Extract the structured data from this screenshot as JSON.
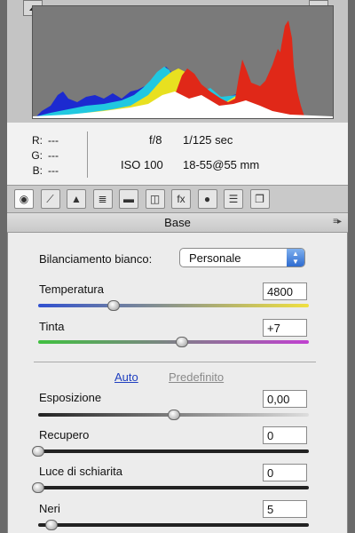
{
  "histogram": {
    "clip_left_icon": "triangle-up-icon",
    "clip_right_icon": "triangle-up-icon"
  },
  "readout": {
    "r_label": "R:",
    "r_value": "---",
    "g_label": "G:",
    "g_value": "---",
    "b_label": "B:",
    "b_value": "---",
    "aperture": "f/8",
    "shutter": "1/125 sec",
    "iso": "ISO 100",
    "lens": "18-55@55 mm"
  },
  "tabs": [
    {
      "icon": "aperture-icon",
      "glyph": "◉",
      "active": true
    },
    {
      "icon": "tone-curve-icon",
      "glyph": "⟋",
      "active": false
    },
    {
      "icon": "detail-icon",
      "glyph": "▲",
      "active": false
    },
    {
      "icon": "hsl-icon",
      "glyph": "≣",
      "active": false
    },
    {
      "icon": "split-toning-icon",
      "glyph": "▬",
      "active": false
    },
    {
      "icon": "lens-corrections-icon",
      "glyph": "◫",
      "active": false
    },
    {
      "icon": "fx-icon",
      "glyph": "fx",
      "active": false
    },
    {
      "icon": "camera-calibration-icon",
      "glyph": "●",
      "active": false
    },
    {
      "icon": "presets-icon",
      "glyph": "☰",
      "active": false
    },
    {
      "icon": "snapshots-icon",
      "glyph": "❐",
      "active": false
    }
  ],
  "section": {
    "title": "Base",
    "menu_glyph": "≡▸"
  },
  "white_balance": {
    "label": "Bilanciamento bianco:",
    "value": "Personale",
    "arrow_glyph": "▲▼"
  },
  "controls": [
    {
      "label": "Temperatura",
      "value": "4800",
      "level": 0.28
    },
    {
      "label": "Tinta",
      "value": "+7",
      "level": 0.53
    },
    {
      "label": "Esposizione",
      "value": "0,00",
      "level": 0.5
    },
    {
      "label": "Recupero",
      "value": "0",
      "level": 0.0
    },
    {
      "label": "Luce di schiarita",
      "value": "0",
      "level": 0.0
    },
    {
      "label": "Neri",
      "value": "5",
      "level": 0.05
    }
  ],
  "links": {
    "auto": "Auto",
    "default": "Predefinito"
  },
  "colors": {
    "link_active": "#2040c0",
    "link_disabled": "#8a8a8a",
    "temp_track": [
      "#3050d0",
      "#f0e040"
    ],
    "tint_track": [
      "#40c040",
      "#c040d0"
    ]
  }
}
